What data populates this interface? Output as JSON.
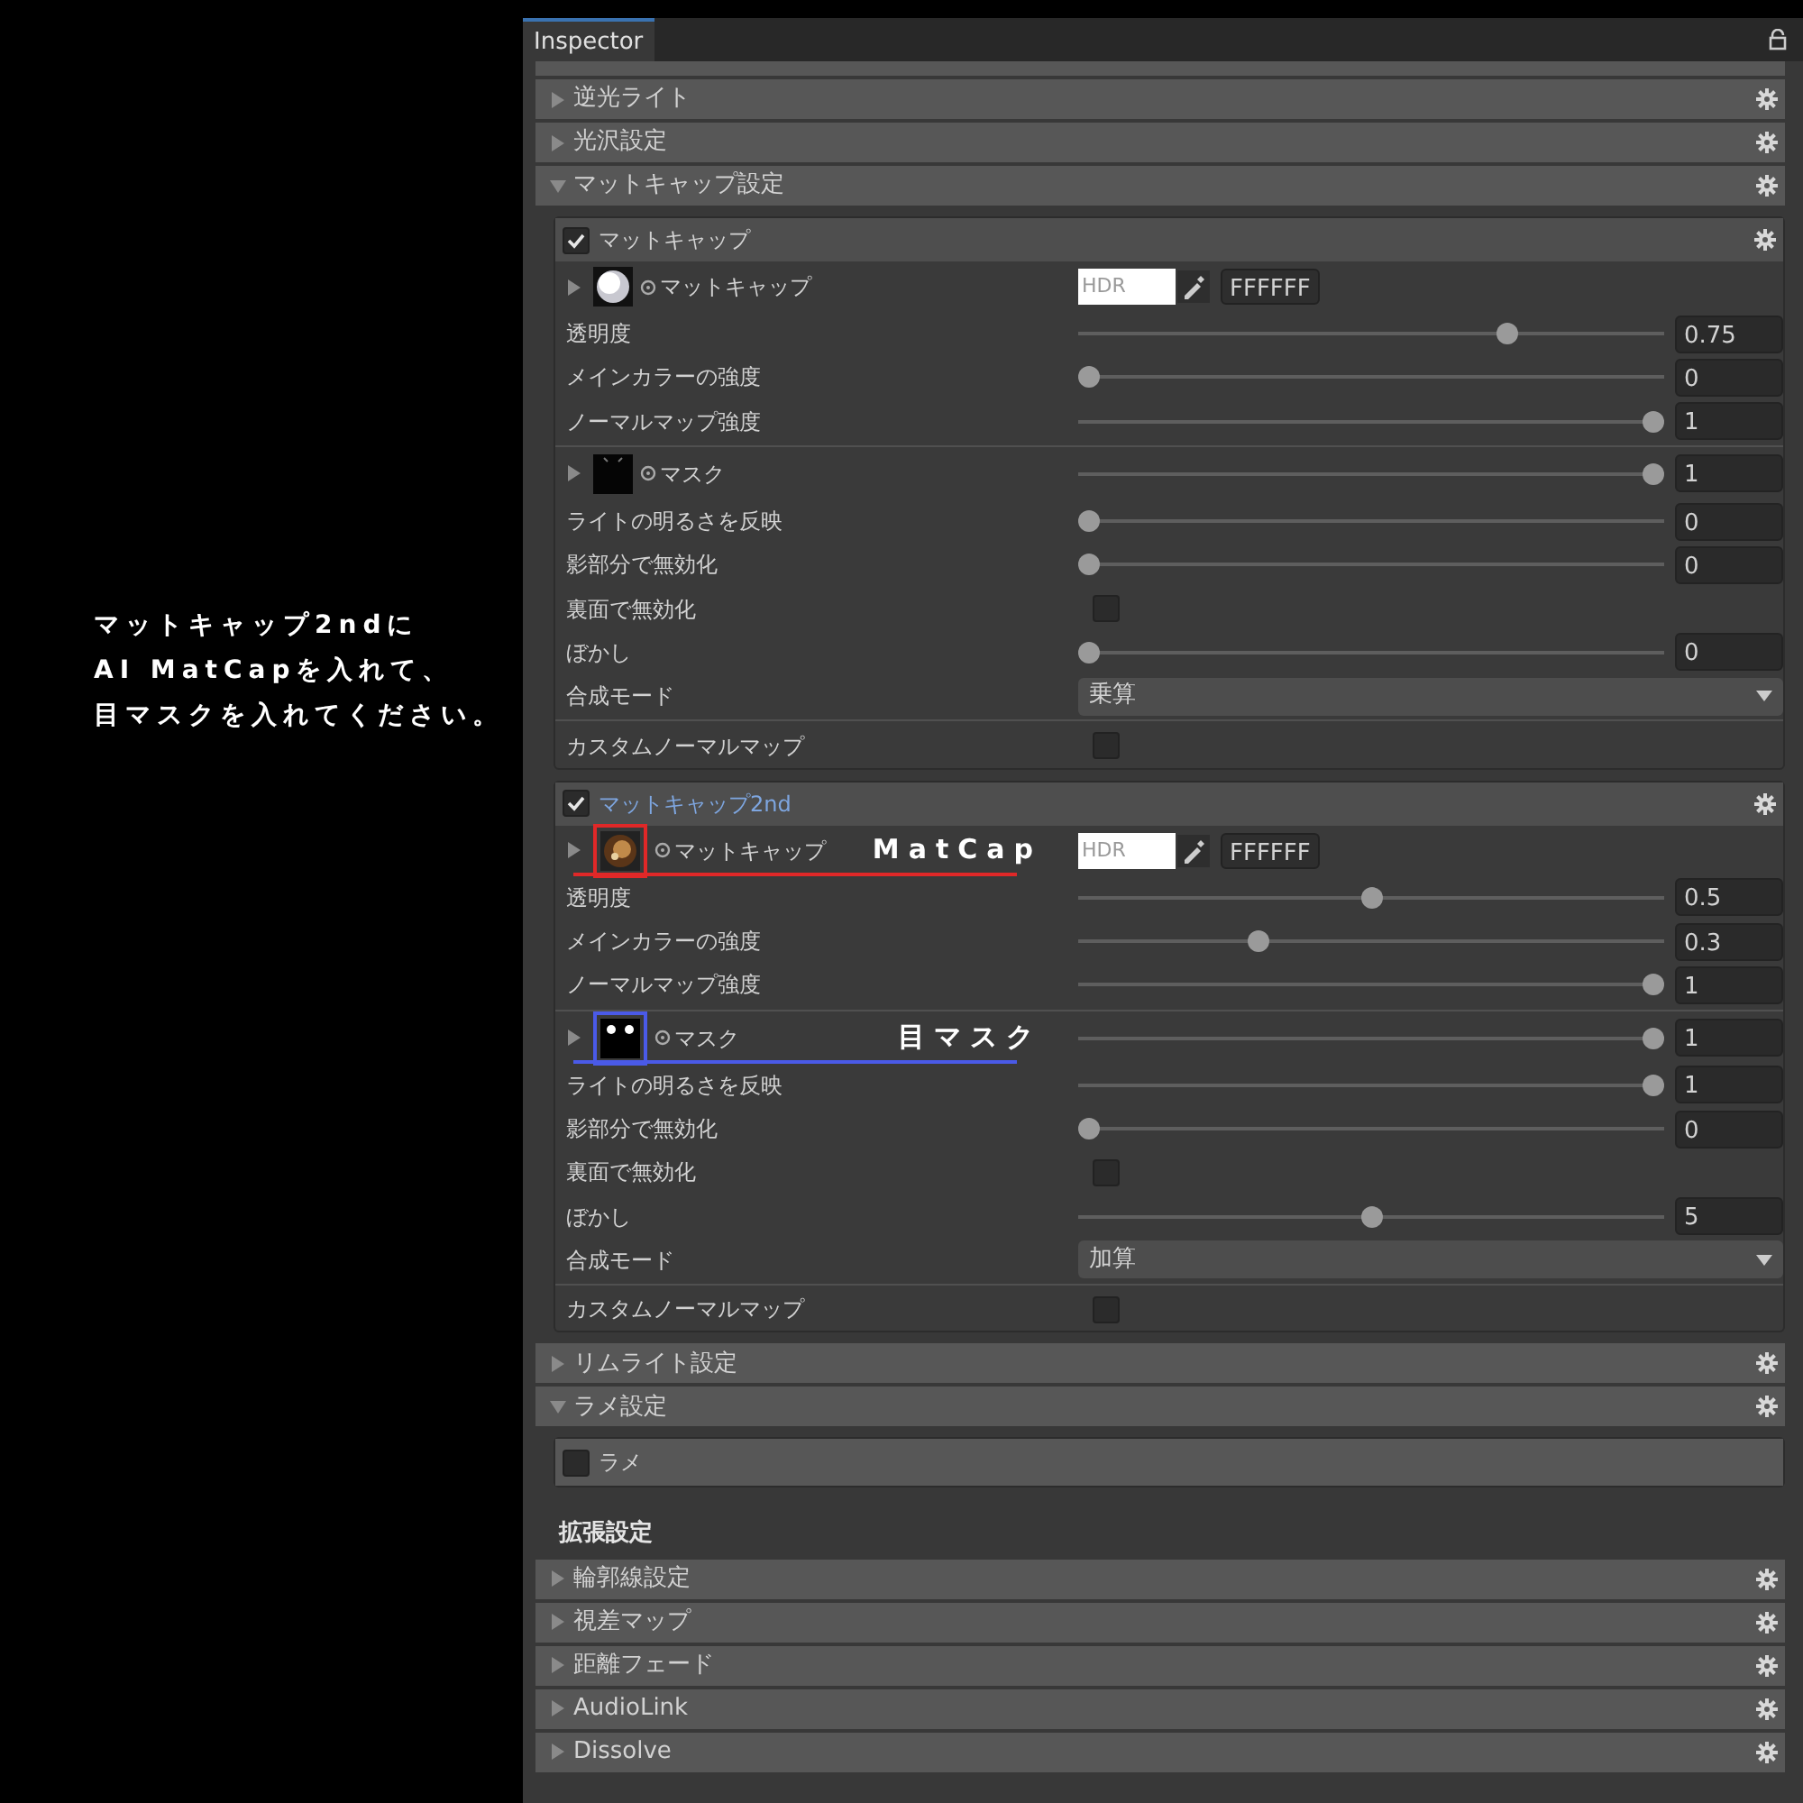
{
  "annotation": {
    "lines": [
      "マットキャップ2ndに",
      "AI MatCapを入れて、",
      "目マスクを入れてください。"
    ]
  },
  "window": {
    "title": "Inspector",
    "locked": false
  },
  "sections": [
    {
      "kind": "header",
      "label": "逆光ライト",
      "expanded": false
    },
    {
      "kind": "header",
      "label": "光沢設定",
      "expanded": false
    },
    {
      "kind": "header",
      "label": "マットキャップ設定",
      "expanded": true
    },
    {
      "kind": "group",
      "label": "マットキャップ",
      "checked": true,
      "modified": false,
      "rows": [
        {
          "kind": "texture",
          "label": "マットキャップ",
          "hdr": "HDR",
          "hex": "FFFFFF"
        },
        {
          "kind": "slider",
          "label": "透明度",
          "level": 0.74,
          "value": "0.75"
        },
        {
          "kind": "slider",
          "label": "メインカラーの強度",
          "level": 0,
          "value": "0"
        },
        {
          "kind": "slider",
          "label": "ノーマルマップ強度",
          "level": 1,
          "value": "1"
        },
        {
          "kind": "separator"
        },
        {
          "kind": "texture",
          "label": "マスク",
          "level": 1,
          "value": "1"
        },
        {
          "kind": "slider",
          "label": "ライトの明るさを反映",
          "level": 0,
          "value": "0"
        },
        {
          "kind": "slider",
          "label": "影部分で無効化",
          "level": 0,
          "value": "0"
        },
        {
          "kind": "checkbox",
          "label": "裏面で無効化",
          "checked": false
        },
        {
          "kind": "slider",
          "label": "ぼかし",
          "level": 0,
          "value": "0"
        },
        {
          "kind": "dropdown",
          "label": "合成モード",
          "value": "乗算"
        },
        {
          "kind": "separator"
        },
        {
          "kind": "checkbox",
          "label": "カスタムノーマルマップ",
          "checked": false
        }
      ]
    },
    {
      "kind": "group",
      "label": "マットキャップ2nd",
      "checked": true,
      "modified": true,
      "rows": [
        {
          "kind": "texture",
          "label": "マットキャップ",
          "hdr": "HDR",
          "hex": "FFFFFF",
          "callout": {
            "text": "MatCap",
            "color": "#e02828"
          }
        },
        {
          "kind": "slider",
          "label": "透明度",
          "level": 0.5,
          "value": "0.5"
        },
        {
          "kind": "slider",
          "label": "メインカラーの強度",
          "level": 0.3,
          "value": "0.3"
        },
        {
          "kind": "slider",
          "label": "ノーマルマップ強度",
          "level": 1,
          "value": "1"
        },
        {
          "kind": "separator"
        },
        {
          "kind": "texture",
          "label": "マスク",
          "level": 1,
          "value": "1",
          "callout": {
            "text": "目マスク",
            "color": "#4a5ae8"
          }
        },
        {
          "kind": "slider",
          "label": "ライトの明るさを反映",
          "level": 1,
          "value": "1"
        },
        {
          "kind": "slider",
          "label": "影部分で無効化",
          "level": 0,
          "value": "0"
        },
        {
          "kind": "checkbox",
          "label": "裏面で無効化",
          "checked": false
        },
        {
          "kind": "slider",
          "label": "ぼかし",
          "level": 0.5,
          "value": "5"
        },
        {
          "kind": "dropdown",
          "label": "合成モード",
          "value": "加算"
        },
        {
          "kind": "separator"
        },
        {
          "kind": "checkbox",
          "label": "カスタムノーマルマップ",
          "checked": false
        }
      ]
    },
    {
      "kind": "header",
      "label": "リムライト設定",
      "expanded": false
    },
    {
      "kind": "header",
      "label": "ラメ設定",
      "expanded": true
    },
    {
      "kind": "group",
      "label": "ラメ",
      "checked": false,
      "modified": false
    },
    {
      "kind": "heading",
      "label": "拡張設定"
    },
    {
      "kind": "header",
      "label": "輪郭線設定",
      "expanded": false
    },
    {
      "kind": "header",
      "label": "視差マップ",
      "expanded": false
    },
    {
      "kind": "header",
      "label": "距離フェード",
      "expanded": false
    },
    {
      "kind": "header",
      "label": "AudioLink",
      "expanded": false
    },
    {
      "kind": "header",
      "label": "Dissolve",
      "expanded": false
    }
  ]
}
